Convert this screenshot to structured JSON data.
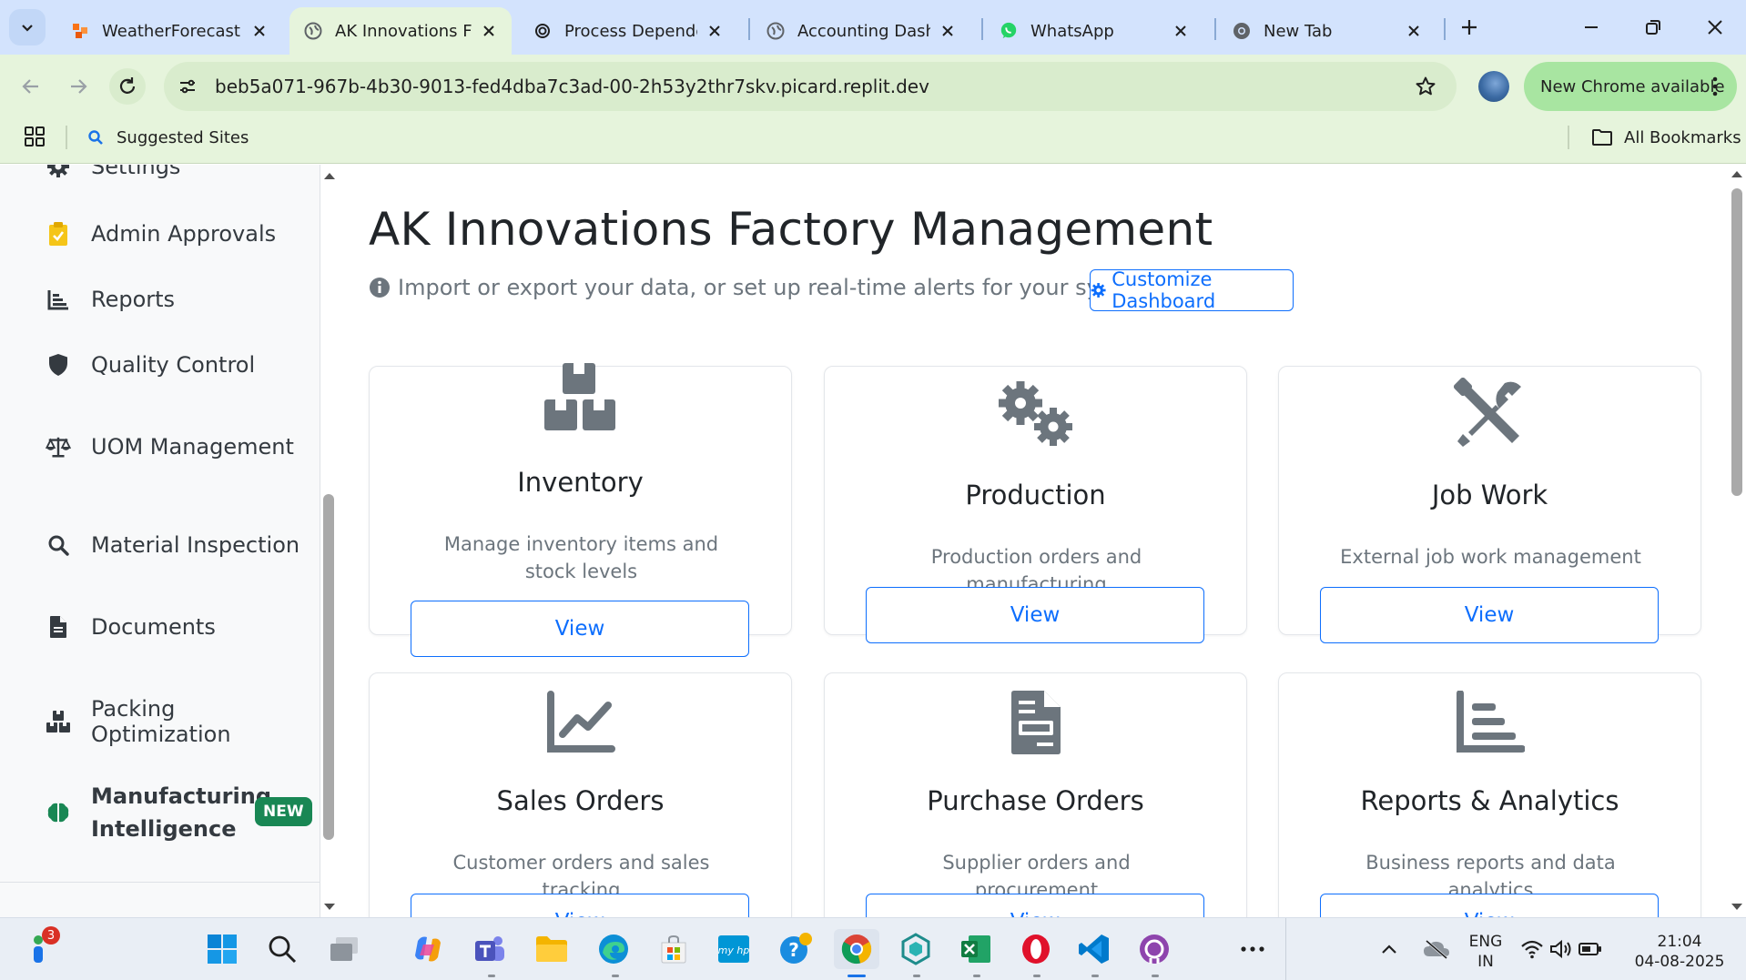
{
  "browser": {
    "tabs": [
      {
        "title": "WeatherForecast -",
        "favicon_color": "#f97316"
      },
      {
        "title": "AK Innovations Fac",
        "favicon_color": "#5f6368",
        "active": true
      },
      {
        "title": "Process Dependen",
        "favicon_color": "#1f1f1f"
      },
      {
        "title": "Accounting Dashb",
        "favicon_color": "#5f6368"
      },
      {
        "title": "WhatsApp",
        "favicon_color": "#25d366"
      },
      {
        "title": "New Tab",
        "favicon_color": "#5f6368"
      }
    ],
    "url": "beb5a071-967b-4b30-9013-fed4dba7c3ad-00-2h53y2thr7skv.picard.replit.dev",
    "update_label": "New Chrome available",
    "bookmarks": {
      "suggested": "Suggested Sites",
      "all": "All Bookmarks"
    }
  },
  "sidebar": {
    "items": [
      {
        "label": "Settings",
        "icon": "gear-icon"
      },
      {
        "label": "Admin Approvals",
        "icon": "clipboard-check-icon"
      },
      {
        "label": "Reports",
        "icon": "bar-chart-icon"
      },
      {
        "label": "Quality Control",
        "icon": "shield-icon"
      },
      {
        "label": "UOM Management",
        "icon": "scale-icon"
      },
      {
        "label": "Material Inspection",
        "icon": "search-icon"
      },
      {
        "label": "Documents",
        "icon": "file-icon"
      },
      {
        "label": "Packing Optimization",
        "icon": "boxes-icon"
      }
    ],
    "manufacturing": {
      "line1": "Manufacturing",
      "line2": "Intelligence",
      "badge": "NEW",
      "icon": "brain-icon"
    }
  },
  "main": {
    "title": "AK Innovations Factory Management",
    "subtitle": "Import or export your data, or set up real-time alerts for your system.",
    "customize_label": "Customize Dashboard",
    "cards": [
      {
        "title": "Inventory",
        "desc": "Manage inventory items and stock levels",
        "button": "View",
        "icon": "boxes-icon"
      },
      {
        "title": "Production",
        "desc": "Production orders and manufacturing",
        "button": "View",
        "icon": "gears-icon"
      },
      {
        "title": "Job Work",
        "desc": "External job work management",
        "button": "View",
        "icon": "tools-icon"
      },
      {
        "title": "Sales Orders",
        "desc": "Customer orders and sales tracking",
        "button": "View",
        "icon": "chart-line-icon"
      },
      {
        "title": "Purchase Orders",
        "desc": "Supplier orders and procurement",
        "button": "View",
        "icon": "file-invoice-icon"
      },
      {
        "title": "Reports & Analytics",
        "desc": "Business reports and data analytics",
        "button": "View",
        "icon": "chart-bar-icon"
      }
    ]
  },
  "taskbar": {
    "notification_count": "3",
    "lang1": "ENG",
    "lang2": "IN",
    "time": "21:04",
    "date": "04-08-2025"
  },
  "colors": {
    "primary": "#0d6efd",
    "success": "#198754",
    "icon_gray": "#5f6368"
  }
}
